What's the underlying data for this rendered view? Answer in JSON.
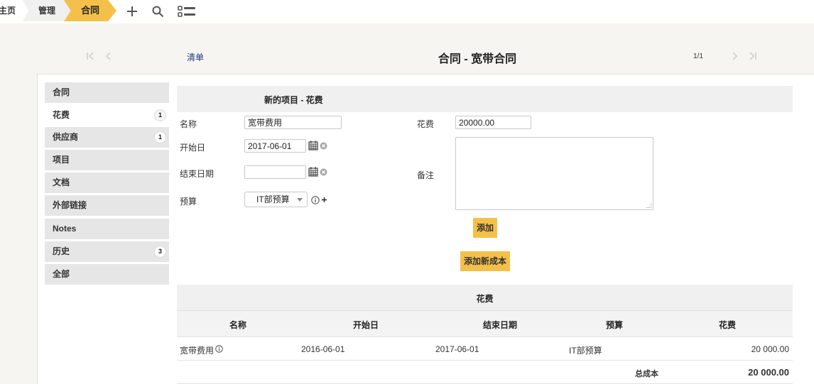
{
  "breadcrumb": {
    "home": "主页",
    "manage": "管理",
    "current": "合同"
  },
  "toolbar": {
    "icons": [
      "plus-icon",
      "search-icon",
      "list-view-icon"
    ]
  },
  "header": {
    "list_link": "清单",
    "title": "合同 - 宽带合同",
    "page_count": "1/1"
  },
  "sidebar": {
    "items": [
      {
        "label": "合同",
        "badge": ""
      },
      {
        "label": "花费",
        "badge": "1"
      },
      {
        "label": "供应商",
        "badge": "1"
      },
      {
        "label": "项目",
        "badge": ""
      },
      {
        "label": "文档",
        "badge": ""
      },
      {
        "label": "外部链接",
        "badge": ""
      },
      {
        "label": "Notes",
        "badge": ""
      },
      {
        "label": "历史",
        "badge": "3"
      },
      {
        "label": "全部",
        "badge": ""
      }
    ]
  },
  "form": {
    "title": "新的项目 - 花费",
    "name_label": "名称",
    "name_value": "宽带费用",
    "start_label": "开始日",
    "start_value": "2017-06-01",
    "end_label": "结束日期",
    "end_value": "",
    "budget_label": "预算",
    "budget_value": "IT部预算",
    "cost_label": "花费",
    "cost_value": "20000.00",
    "note_label": "备注",
    "add_button": "添加",
    "add_cost_button": "添加新成本"
  },
  "table": {
    "title": "花费",
    "columns": [
      "名称",
      "开始日",
      "结束日期",
      "预算",
      "花费"
    ],
    "rows": [
      {
        "name": "宽带费用",
        "start": "2016-06-01",
        "end": "2017-06-01",
        "budget": "IT部预算",
        "cost": "20 000.00"
      }
    ],
    "total_label": "总成本",
    "total_value": "20 000.00"
  }
}
